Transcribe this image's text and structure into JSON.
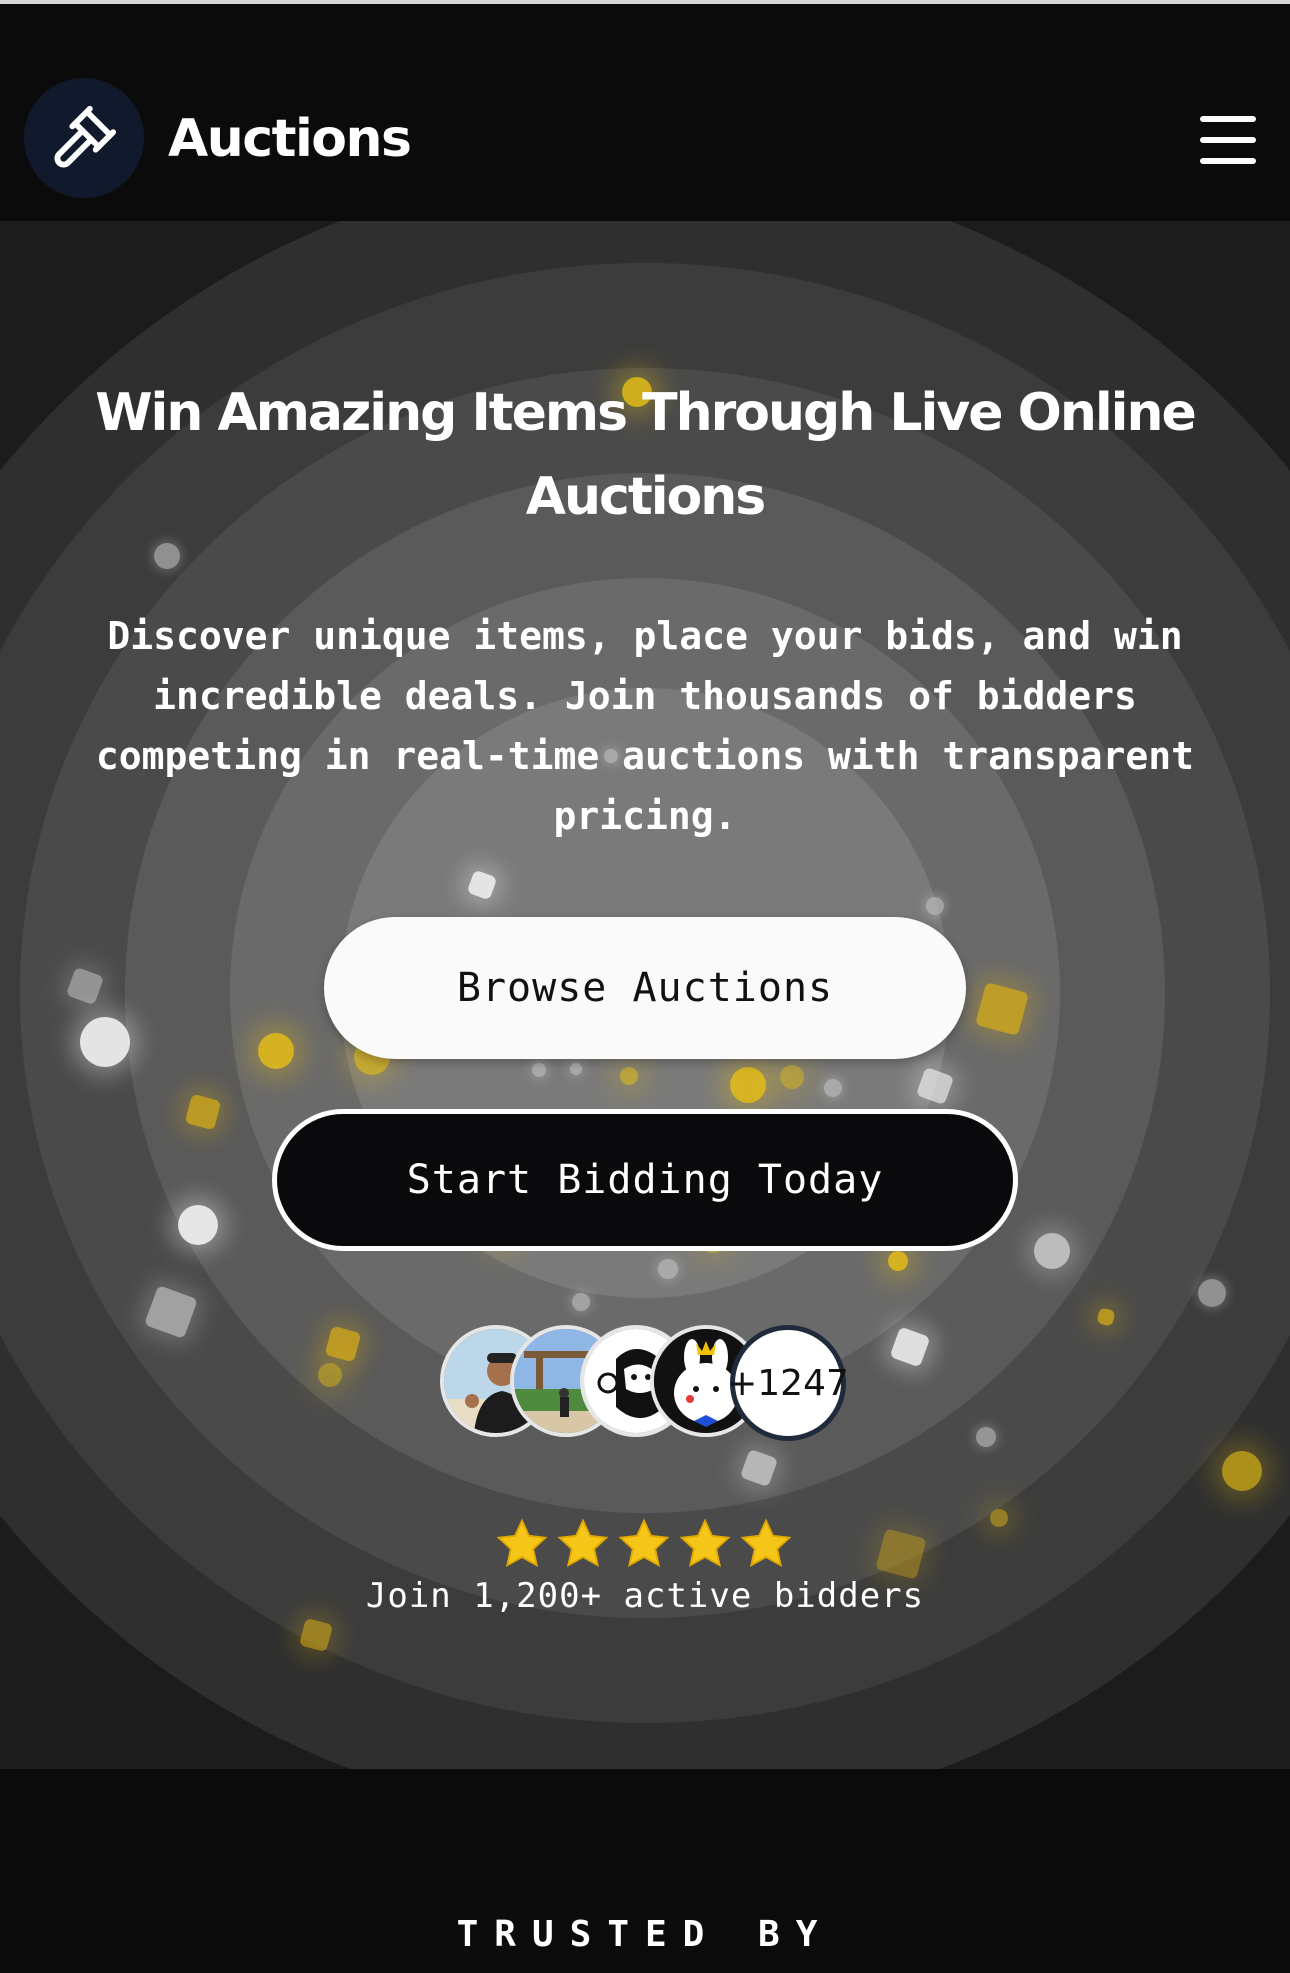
{
  "header": {
    "logo_icon": "gavel-icon",
    "brand": "Auctions",
    "menu_icon": "hamburger-menu-icon"
  },
  "hero": {
    "title": "Win Amazing Items Through Live Online Auctions",
    "subtitle": "Discover unique items, place your bids, and win incredible deals. Join thousands of bidders competing in real-time auctions with transparent pricing.",
    "primary_button": "Browse Auctions",
    "secondary_button": "Start Bidding Today",
    "avatars": [
      "avatar-man-thumbs-up",
      "avatar-person-at-shrine",
      "avatar-bearded-cartoon",
      "avatar-bunny-cartoon"
    ],
    "avatar_more": "+1247",
    "rating_stars": 5,
    "bidders_text": "Join 1,200+ active bidders"
  },
  "trusted": {
    "label": "TRUSTED BY"
  },
  "colors": {
    "background": "#0b0b0b",
    "logo_bg": "#111a2c",
    "accent_yellow": "#f5c518",
    "button_light": "#fafafa",
    "button_dark": "#0a0a0c"
  }
}
